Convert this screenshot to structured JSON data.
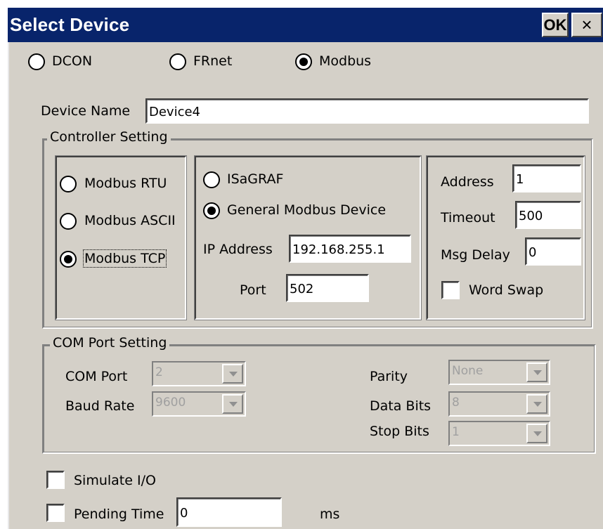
{
  "window": {
    "title": "Select Device",
    "ok_label": "OK",
    "close_label": "×"
  },
  "protocol": {
    "options": [
      {
        "label": "DCON",
        "selected": false
      },
      {
        "label": "FRnet",
        "selected": false
      },
      {
        "label": "Modbus",
        "selected": true
      }
    ]
  },
  "device_name": {
    "label": "Device Name",
    "value": "Device4"
  },
  "controller": {
    "legend": "Controller Setting",
    "modes": [
      {
        "label": "Modbus RTU",
        "selected": false
      },
      {
        "label": "Modbus ASCII",
        "selected": false
      },
      {
        "label": "Modbus TCP",
        "selected": true
      }
    ],
    "device_types": [
      {
        "label": "ISaGRAF",
        "selected": false
      },
      {
        "label": "General Modbus Device",
        "selected": true
      }
    ],
    "ip_label": "IP Address",
    "ip_value": "192.168.255.1",
    "port_label": "Port",
    "port_value": "502",
    "address_label": "Address",
    "address_value": "1",
    "timeout_label": "Timeout",
    "timeout_value": "500",
    "msg_delay_label": "Msg Delay",
    "msg_delay_value": "0",
    "word_swap_label": "Word Swap",
    "word_swap_checked": false
  },
  "com_port": {
    "legend": "COM Port Setting",
    "com_port_label": "COM Port",
    "com_port_value": "2",
    "baud_rate_label": "Baud Rate",
    "baud_rate_value": "9600",
    "parity_label": "Parity",
    "parity_value": "None",
    "data_bits_label": "Data Bits",
    "data_bits_value": "8",
    "stop_bits_label": "Stop Bits",
    "stop_bits_value": "1"
  },
  "simulate_io": {
    "label": "Simulate I/O",
    "checked": false
  },
  "pending_time": {
    "label": "Pending Time",
    "checked": false,
    "value": "0",
    "unit": "ms"
  },
  "colors": {
    "titlebar": "#08246b",
    "face": "#d4d0c8"
  }
}
